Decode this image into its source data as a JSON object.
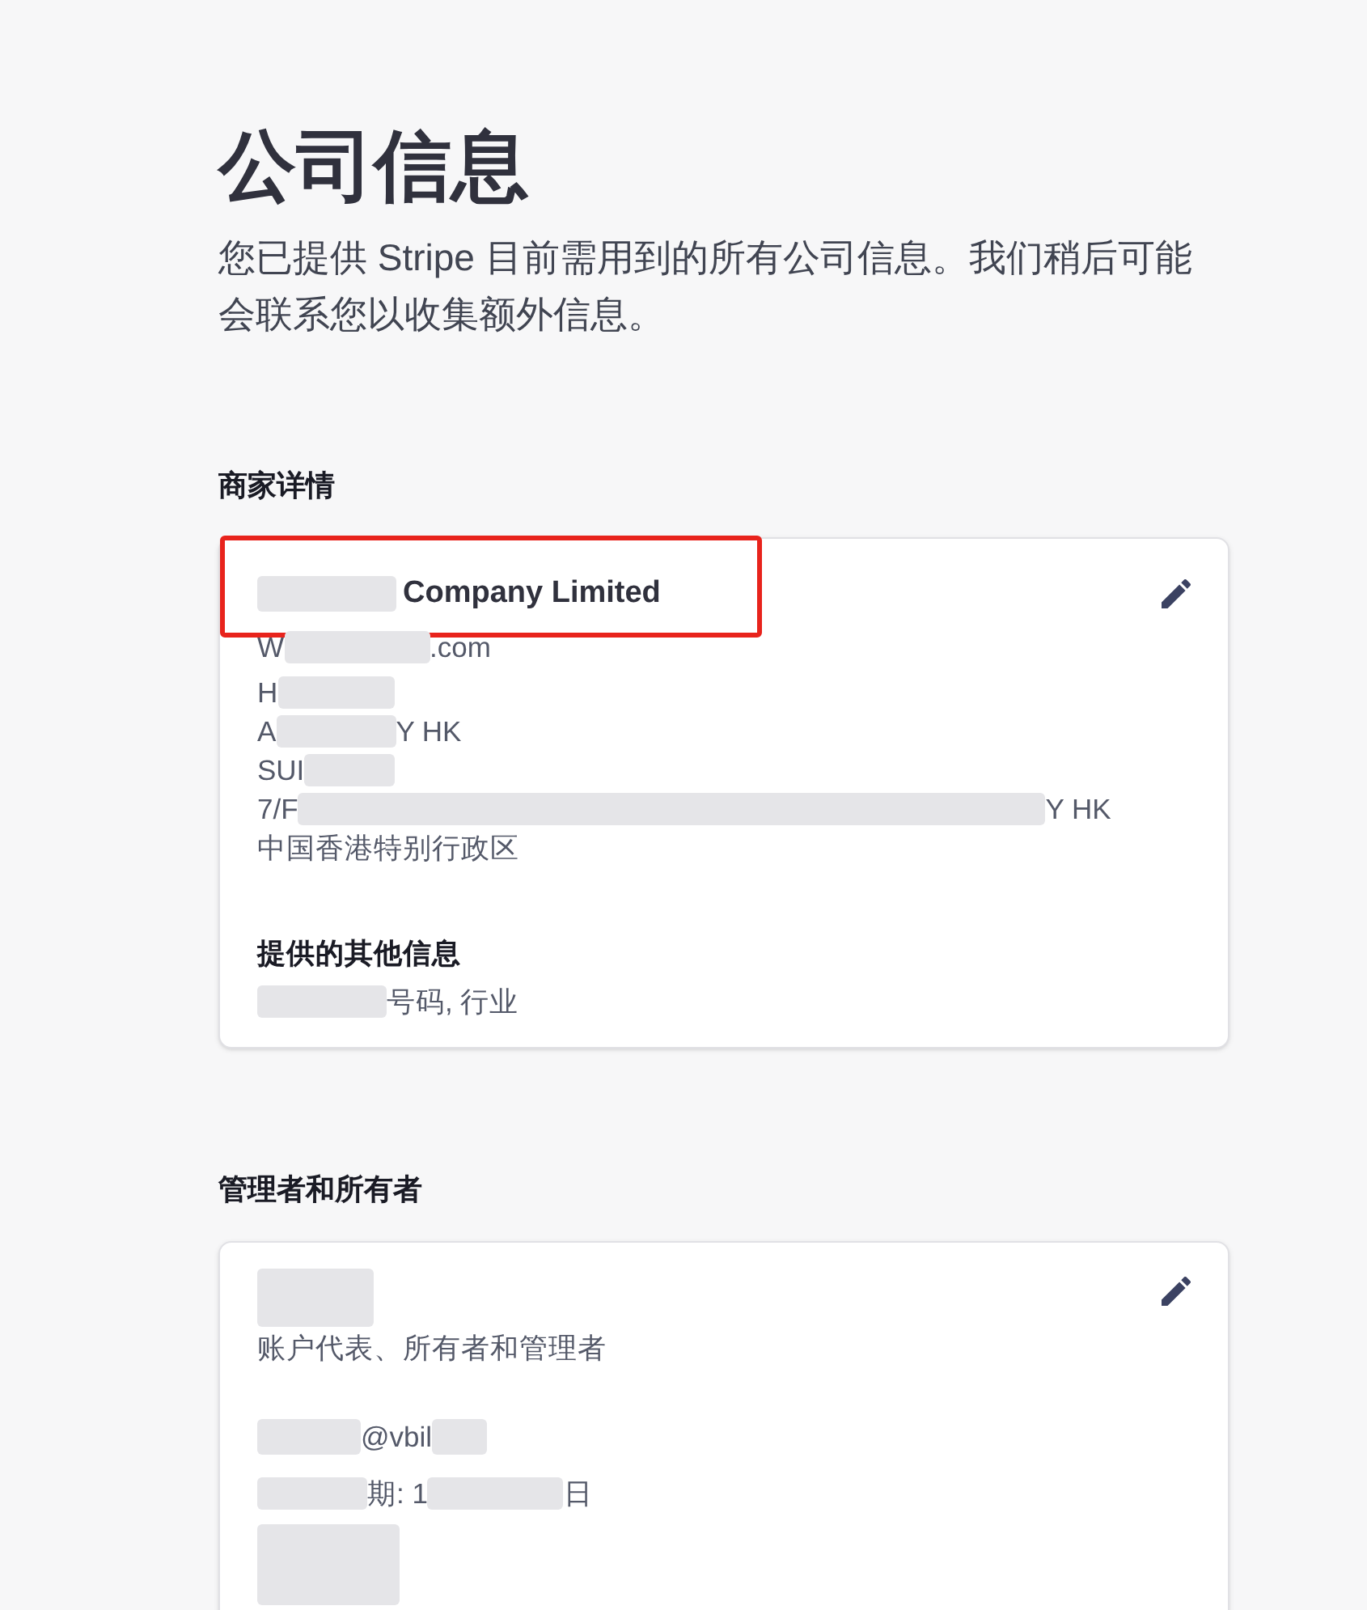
{
  "page": {
    "title": "公司信息",
    "description": "您已提供 Stripe 目前需用到的所有公司信息。我们稍后可能会联系您以收集额外信息。"
  },
  "sections": [
    {
      "heading": "商家详情",
      "editable": true,
      "rows": [
        {
          "kind": "name",
          "highlighted": true,
          "parts": [
            {
              "kind": "redacted"
            },
            {
              "kind": "text",
              "text": "Company Limited"
            }
          ]
        },
        {
          "kind": "detail",
          "parts": [
            {
              "kind": "text",
              "text": "W"
            },
            {
              "kind": "redacted"
            },
            {
              "kind": "text",
              "text": ".com"
            }
          ]
        },
        {
          "kind": "detail",
          "parts": [
            {
              "kind": "text",
              "text": "H"
            },
            {
              "kind": "redacted"
            }
          ]
        },
        {
          "kind": "detail",
          "parts": [
            {
              "kind": "text",
              "text": "A"
            },
            {
              "kind": "redacted"
            },
            {
              "kind": "text",
              "text": "Y HK"
            }
          ]
        },
        {
          "kind": "detail",
          "parts": [
            {
              "kind": "text",
              "text": "SUI"
            },
            {
              "kind": "redacted"
            }
          ]
        },
        {
          "kind": "detail",
          "parts": [
            {
              "kind": "text",
              "text": "7/F"
            },
            {
              "kind": "redacted"
            },
            {
              "kind": "text",
              "text": "Y HK"
            }
          ]
        },
        {
          "kind": "detail",
          "parts": [
            {
              "kind": "text",
              "text": "中国香港特别行政区"
            }
          ]
        },
        {
          "kind": "label",
          "parts": [
            {
              "kind": "text",
              "text": "提供的其他信息"
            }
          ]
        },
        {
          "kind": "detail",
          "parts": [
            {
              "kind": "redacted"
            },
            {
              "kind": "text",
              "text": "号码, 行业"
            }
          ]
        }
      ]
    },
    {
      "heading": "管理者和所有者",
      "editable": true,
      "rows": [
        {
          "kind": "name",
          "parts": [
            {
              "kind": "redacted"
            }
          ]
        },
        {
          "kind": "detail",
          "parts": [
            {
              "kind": "text",
              "text": "账户代表、所有者和管理者"
            }
          ]
        },
        {
          "kind": "detail",
          "parts": [
            {
              "kind": "redacted"
            },
            {
              "kind": "text",
              "text": "@vbil"
            },
            {
              "kind": "redacted"
            }
          ]
        },
        {
          "kind": "detail",
          "parts": [
            {
              "kind": "redacted"
            },
            {
              "kind": "text",
              "text": "期: 1"
            },
            {
              "kind": "redacted"
            },
            {
              "kind": "text",
              "text": "日"
            }
          ]
        },
        {
          "kind": "detail",
          "parts": [
            {
              "kind": "redacted"
            }
          ]
        }
      ]
    }
  ]
}
